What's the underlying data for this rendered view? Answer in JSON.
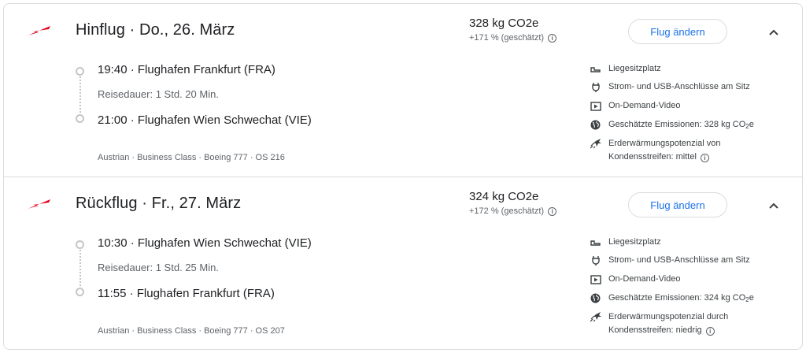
{
  "flights": [
    {
      "title": "Hinflug · Do., 26. März",
      "departure": "19:40  ·  Flughafen Frankfurt (FRA)",
      "duration": "Reisedauer: 1 Std. 20 Min.",
      "arrival": "21:00  ·  Flughafen Wien Schwechat (VIE)",
      "details": "Austrian · Business Class · Boeing 777 · OS 216",
      "co2": "328 kg CO2e",
      "co2_delta": "+171 % (geschätzt)",
      "change_label": "Flug ändern",
      "amenities": {
        "seat": "Liegesitzplatz",
        "power": "Strom- und USB-Anschlüsse am Sitz",
        "video": "On-Demand-Video",
        "emissions_prefix": "Geschätzte Emissionen: 328 kg CO",
        "emissions_sub": "2",
        "emissions_suffix": "e",
        "contrail_line1": "Erderwärmungspotenzial von",
        "contrail_line2": "Kondensstreifen: mittel"
      }
    },
    {
      "title": "Rückflug · Fr., 27. März",
      "departure": "10:30  ·  Flughafen Wien Schwechat (VIE)",
      "duration": "Reisedauer: 1 Std. 25 Min.",
      "arrival": "11:55  ·  Flughafen Frankfurt (FRA)",
      "details": "Austrian · Business Class · Boeing 777 · OS 207",
      "co2": "324 kg CO2e",
      "co2_delta": "+172 % (geschätzt)",
      "change_label": "Flug ändern",
      "amenities": {
        "seat": "Liegesitzplatz",
        "power": "Strom- und USB-Anschlüsse am Sitz",
        "video": "On-Demand-Video",
        "emissions_prefix": "Geschätzte Emissionen: 324 kg CO",
        "emissions_sub": "2",
        "emissions_suffix": "e",
        "contrail_line1": "Erderwärmungspotenzial durch",
        "contrail_line2": "Kondensstreifen: niedrig"
      }
    }
  ],
  "colors": {
    "accent": "#1a73e8",
    "airline": "#e2001a",
    "muted": "#5f6368"
  },
  "icons": [
    "austrian-logo",
    "info-icon",
    "chevron-up-icon",
    "seat-icon",
    "power-plug-icon",
    "video-icon",
    "globe-icon",
    "contrail-icon"
  ]
}
